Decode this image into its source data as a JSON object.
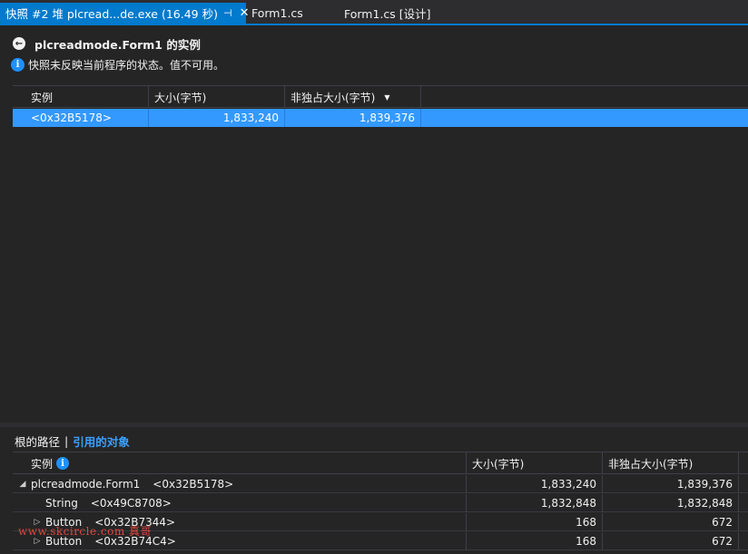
{
  "tabs": [
    {
      "label": "快照 #2 堆 plcread...de.exe (16.49 秒)",
      "active": true
    },
    {
      "label": "Form1.cs",
      "active": false
    },
    {
      "label": "Form1.cs [设计]",
      "active": false
    }
  ],
  "icons": {
    "pin": "pin-icon",
    "close": "close-icon",
    "back": "back-circle-icon",
    "info": "info-icon"
  },
  "header": {
    "title": "plcreadmode.Form1 的实例",
    "info": "快照未反映当前程序的状态。值不可用。"
  },
  "instances_table": {
    "columns": [
      "实例",
      "大小(字节)",
      "非独占大小(字节)"
    ],
    "sort_indicator": "▼",
    "rows": [
      {
        "instance": "<0x32B5178>",
        "size": "1,833,240",
        "inclusive_size": "1,839,376",
        "selected": true
      }
    ]
  },
  "lower_pane": {
    "tab_roots": "根的路径",
    "separator": "|",
    "tab_refs": "引用的对象",
    "columns": [
      "实例",
      "大小(字节)",
      "非独占大小(字节)"
    ],
    "rows": [
      {
        "expander": "◢",
        "name": "plcreadmode.Form1",
        "addr": "<0x32B5178>",
        "size": "1,833,240",
        "inclusive_size": "1,839,376"
      },
      {
        "expander": "",
        "name": "String",
        "addr": "<0x49C8708>",
        "size": "1,832,848",
        "inclusive_size": "1,832,848"
      },
      {
        "expander": "▷",
        "name": "Button",
        "addr": "<0x32B7344>",
        "size": "168",
        "inclusive_size": "672"
      },
      {
        "expander": "▷",
        "name": "Button",
        "addr": "<0x32B74C4>",
        "size": "168",
        "inclusive_size": "672"
      }
    ]
  },
  "watermark": "www.skcircle.com 真哥"
}
